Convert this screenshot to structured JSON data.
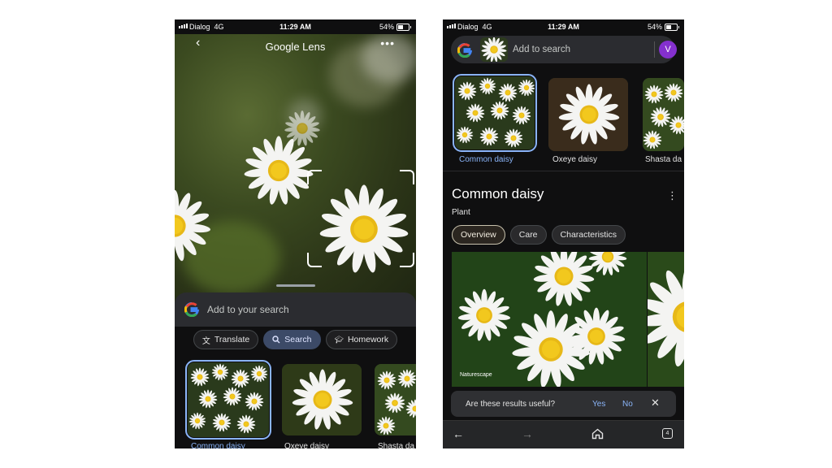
{
  "status_left": {
    "carrier": "Dialog",
    "network": "4G",
    "time": "11:29 AM",
    "battery": "54%"
  },
  "status_right": {
    "carrier": "Dialog",
    "network": "4G",
    "time": "11:29 AM",
    "battery": "54%"
  },
  "left": {
    "title": "Google Lens",
    "search_placeholder": "Add to your search",
    "modes": [
      "Translate",
      "Search",
      "Homework"
    ],
    "active_mode": "Search",
    "results": [
      "Common daisy",
      "Oxeye daisy",
      "Shasta da"
    ]
  },
  "right": {
    "search_placeholder": "Add to search",
    "avatar_initial": "V",
    "results": [
      "Common daisy",
      "Oxeye daisy",
      "Shasta da"
    ],
    "panel": {
      "title": "Common daisy",
      "subtitle": "Plant",
      "tabs": [
        "Overview",
        "Care",
        "Characteristics"
      ],
      "active_tab": "Overview",
      "photo_credit": "Naturescape"
    },
    "feedback": {
      "question": "Are these results useful?",
      "yes": "Yes",
      "no": "No"
    },
    "tab_count": "4"
  },
  "colors": {
    "accent_blue": "#8ab4f8",
    "avatar_purple": "#8430ce",
    "background": "#0f0f10"
  },
  "icons": [
    "back-arrow-icon",
    "more-horiz-icon",
    "google-g-icon",
    "translate-icon",
    "search-icon",
    "homework-icon",
    "more-vert-icon",
    "close-icon",
    "home-icon",
    "forward-arrow-icon",
    "tabs-icon"
  ]
}
